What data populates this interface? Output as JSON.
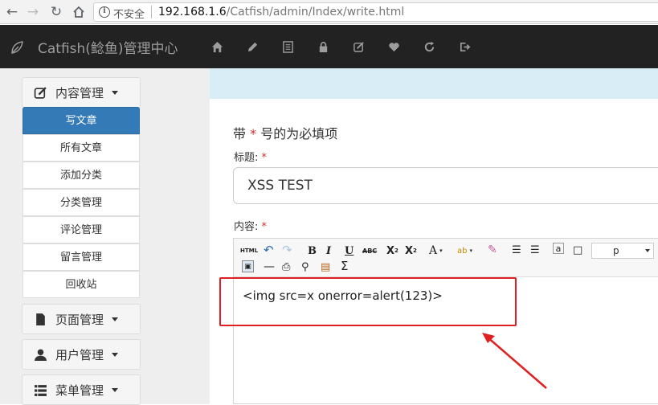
{
  "browser": {
    "back_icon": "back-arrow-icon",
    "forward_icon": "forward-arrow-icon",
    "reload_icon": "reload-icon",
    "home_icon": "home-icon",
    "security_label": "不安全",
    "url_host": "192.168.1.6",
    "url_path": "/Catfish/admin/Index/write.html"
  },
  "navbar": {
    "brand": "Catfish(鲶鱼)管理中心",
    "icons": [
      "home-icon",
      "pencil-icon",
      "list-icon",
      "lock-icon",
      "edit-icon",
      "heart-icon",
      "refresh-icon",
      "logout-icon"
    ]
  },
  "sidebar": {
    "content_group": "内容管理",
    "content_items": [
      {
        "label": "写文章",
        "active": true
      },
      {
        "label": "所有文章",
        "active": false
      },
      {
        "label": "添加分类",
        "active": false
      },
      {
        "label": "分类管理",
        "active": false
      },
      {
        "label": "评论管理",
        "active": false
      },
      {
        "label": "留言管理",
        "active": false
      },
      {
        "label": "回收站",
        "active": false
      }
    ],
    "page_group": "页面管理",
    "user_group": "用户管理",
    "menu_group": "菜单管理"
  },
  "form": {
    "required_note_prefix": "带",
    "required_star": "*",
    "required_note_suffix": "号的为必填项",
    "title_label": "标题:",
    "title_value": "XSS TEST",
    "content_label": "内容:",
    "toolbar_html_label": "HTML",
    "format_select_value": "p",
    "editor_content": "<img src=x onerror=alert(123)>"
  },
  "colors": {
    "navbar_bg": "#222222",
    "active_item": "#337ab7",
    "banner": "#d9edf7",
    "required": "#c9302c",
    "annotation": "#e02020"
  }
}
